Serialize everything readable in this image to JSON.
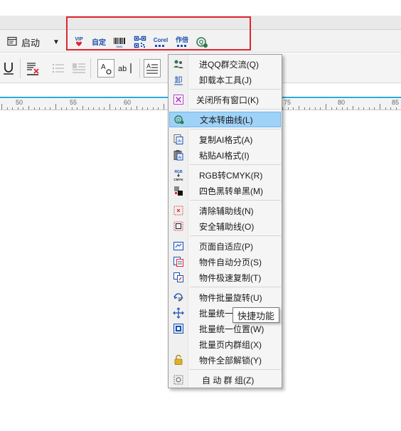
{
  "toolbar": {
    "start_label": "启动",
    "plugins": [
      {
        "name": "vip-icon",
        "text": "VIP"
      },
      {
        "name": "text-define-icon",
        "text": "自定"
      },
      {
        "name": "barcode-icon",
        "text": ""
      },
      {
        "name": "qrcode-icon",
        "text": ""
      },
      {
        "name": "corel-icon",
        "text": "Corel"
      },
      {
        "name": "author-icon",
        "text": "作倍"
      },
      {
        "name": "curve-icon",
        "text": ""
      }
    ]
  },
  "ruler": {
    "ticks": [
      "50",
      "55",
      "60",
      "75",
      "80",
      "85"
    ]
  },
  "menu": {
    "items": [
      {
        "label": "进QQ群交流(Q)",
        "icon": "qq-group-icon"
      },
      {
        "label": "卸载本工具(J)",
        "icon": "uninstall-icon"
      },
      {
        "label": "关闭所有窗口(K)",
        "icon": "close-all-icon"
      },
      {
        "label": "文本转曲线(L)",
        "icon": "text-to-curve-icon"
      },
      {
        "label": "复制AI格式(A)",
        "icon": "copy-ai-icon"
      },
      {
        "label": "粘贴AI格式(I)",
        "icon": "paste-ai-icon"
      },
      {
        "label": "RGB转CMYK(R)",
        "icon": "rgb-cmyk-icon"
      },
      {
        "label": "四色黑转单黑(M)",
        "icon": "four-black-icon"
      },
      {
        "label": "清除辅助线(N)",
        "icon": "clear-guides-icon"
      },
      {
        "label": "安全辅助线(O)",
        "icon": "safe-guides-icon"
      },
      {
        "label": "页面自适应(P)",
        "icon": "page-fit-icon"
      },
      {
        "label": "物件自动分页(S)",
        "icon": "auto-paginate-icon"
      },
      {
        "label": "物件极速复制(T)",
        "icon": "fast-copy-icon"
      },
      {
        "label": "物件批量旋转(U)",
        "icon": "batch-rotate-icon"
      },
      {
        "label": "批量统一",
        "icon": "batch-size-icon"
      },
      {
        "label": "批量统一位置(W)",
        "icon": "batch-position-icon"
      },
      {
        "label": "批量页内群组(X)",
        "icon": ""
      },
      {
        "label": "物件全部解锁(Y)",
        "icon": "unlock-icon"
      },
      {
        "label": "自 动 群 组(Z)",
        "icon": "auto-group-icon"
      }
    ]
  },
  "tooltip": "快捷功能",
  "colors": {
    "highlight": "#9fd2f7",
    "frame": "#e2242e",
    "ruler_line": "#26a9e0"
  }
}
